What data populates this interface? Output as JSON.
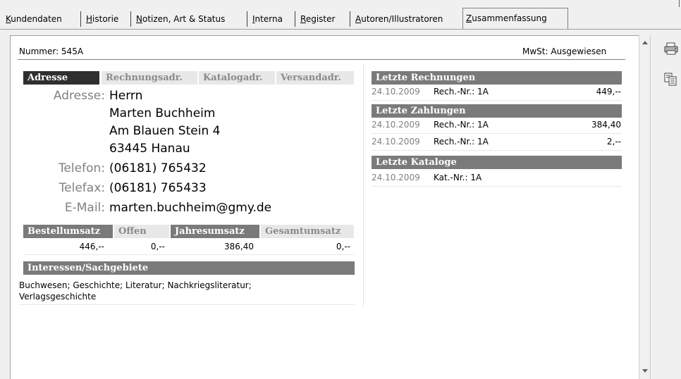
{
  "tabs": [
    {
      "label": "Kundendaten",
      "accel": "K"
    },
    {
      "label": "Historie",
      "accel": "H"
    },
    {
      "label": "Notizen, Art & Status",
      "accel": "N"
    },
    {
      "label": "Interna",
      "accel": "I"
    },
    {
      "label": "Register",
      "accel": "R"
    },
    {
      "label": "Autoren/Illustratoren",
      "accel": "A"
    },
    {
      "label": "Zusammenfassung",
      "accel": "Z"
    }
  ],
  "header": {
    "nummer": "Nummer: 545A",
    "mwst": "MwSt: Ausgewiesen"
  },
  "address_tabs": [
    "Adresse",
    "Rechnungsadr.",
    "Katalogadr.",
    "Versandadr."
  ],
  "address": {
    "label_adresse": "Adresse:",
    "lines": [
      "Herrn",
      "Marten Buchheim",
      "Am Blauen Stein 4",
      "63445 Hanau"
    ],
    "label_telefon": "Telefon:",
    "telefon": "(06181) 765432",
    "label_telefax": "Telefax:",
    "telefax": "(06181) 765433",
    "label_email": "E-Mail:",
    "email": "marten.buchheim@gmy.de"
  },
  "umsatz": {
    "headers": [
      "Bestellumsatz",
      "Offen",
      "Jahresumsatz",
      "Gesamtumsatz"
    ],
    "values": [
      "446,--",
      "0,--",
      "386,40",
      "0,--"
    ]
  },
  "interessen": {
    "title": "Interessen/Sachgebiete",
    "text": "Buchwesen; Geschichte; Literatur; Nachkriegsliteratur; Verlagsgeschichte"
  },
  "rechnungen": {
    "title": "Letzte Rechnungen",
    "rows": [
      {
        "date": "24.10.2009",
        "ref": "Rech.-Nr.: 1A",
        "amount": "449,--"
      }
    ]
  },
  "zahlungen": {
    "title": "Letzte Zahlungen",
    "rows": [
      {
        "date": "24.10.2009",
        "ref": "Rech.-Nr.: 1A",
        "amount": "384,40"
      },
      {
        "date": "24.10.2009",
        "ref": "Rech.-Nr.: 1A",
        "amount": "2,--"
      }
    ]
  },
  "kataloge": {
    "title": "Letzte Kataloge",
    "rows": [
      {
        "date": "24.10.2009",
        "ref": "Kat.-Nr.: 1A"
      }
    ]
  },
  "toolbar": {
    "icons": [
      "printer-icon",
      "copy-icon"
    ]
  }
}
